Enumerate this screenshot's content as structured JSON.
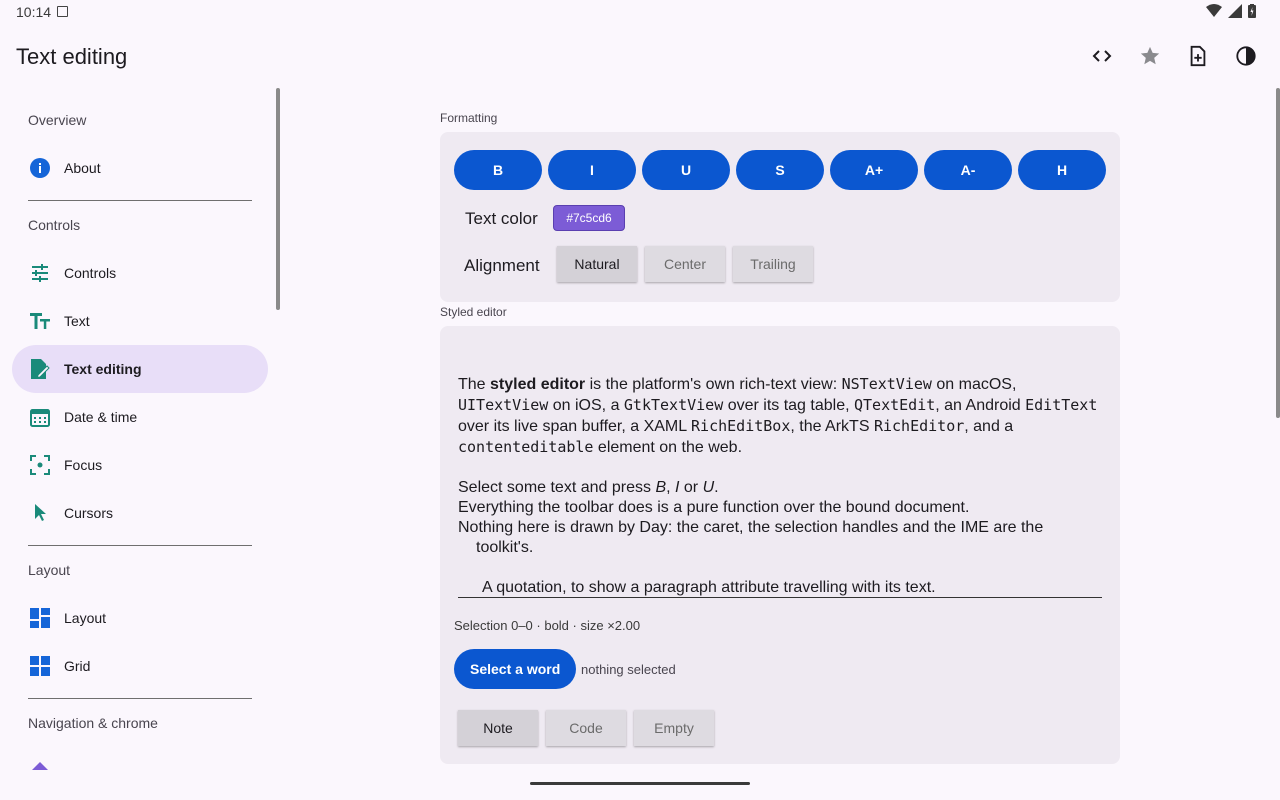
{
  "status": {
    "time": "10:14"
  },
  "appbar": {
    "title": "Text editing",
    "actions": [
      "code-icon",
      "star-icon",
      "new-file-icon",
      "contrast-icon"
    ]
  },
  "sidebar": {
    "sections": [
      {
        "title": "Overview",
        "items": [
          {
            "label": "About",
            "icon": "info-icon"
          }
        ]
      },
      {
        "title": "Controls",
        "items": [
          {
            "label": "Controls",
            "icon": "tune-icon"
          },
          {
            "label": "Text",
            "icon": "text-icon"
          },
          {
            "label": "Text editing",
            "icon": "edit-doc-icon",
            "active": true
          },
          {
            "label": "Date & time",
            "icon": "calendar-icon"
          },
          {
            "label": "Focus",
            "icon": "focus-icon"
          },
          {
            "label": "Cursors",
            "icon": "cursor-icon"
          }
        ]
      },
      {
        "title": "Layout",
        "items": [
          {
            "label": "Layout",
            "icon": "layout-icon"
          },
          {
            "label": "Grid",
            "icon": "grid-icon"
          }
        ]
      },
      {
        "title": "Navigation & chrome",
        "items": []
      }
    ]
  },
  "formatting": {
    "label": "Formatting",
    "buttons": [
      "B",
      "I",
      "U",
      "S",
      "A+",
      "A-",
      "H"
    ],
    "text_color_label": "Text color",
    "text_color_value": "#7c5cd6",
    "alignment_label": "Alignment",
    "alignment_options": [
      "Natural",
      "Center",
      "Trailing"
    ],
    "alignment_selected": "Natural"
  },
  "styled_editor": {
    "label": "Styled editor",
    "p1": {
      "t1": "The ",
      "b1": "styled editor",
      "t2": " is the platform's own rich-text view: ",
      "m1": "NSTextView",
      "t3": " on macOS, ",
      "m2": "UITextView",
      "t4": " on iOS, a ",
      "m3": "GtkTextView",
      "t5": " over its tag table, ",
      "m4": "QTextEdit",
      "t6": ", an Android ",
      "m5": "EditText",
      "t7": " over its live span buffer, a XAML ",
      "m6": "RichEditBox",
      "t8": ", the ArkTS ",
      "m7": "RichEditor",
      "t9": ", and a ",
      "m8": "contenteditable",
      "t10": " element on the web."
    },
    "p2": {
      "t1": "Select some text and press ",
      "i1": "B",
      "t2": ", ",
      "i2": "I",
      "t3": " or ",
      "i3": "U",
      "t4": "."
    },
    "p3": "Everything the toolbar does is a pure function over the bound document.",
    "p4": "Nothing here is drawn by Day: the caret, the selection handles and the IME are the toolkit's.",
    "p5": "A quotation, to show a paragraph attribute travelling with its text.",
    "selection_info": "Selection 0–0 · bold · size ×2.00",
    "select_word_label": "Select a word",
    "selection_status": "nothing selected",
    "presets": [
      "Note",
      "Code",
      "Empty"
    ],
    "preset_selected": "Note"
  },
  "colors": {
    "accent": "#0b57d0",
    "nav_active": "#e8def8",
    "card": "#efeaf2",
    "chip": "#7c5cd6",
    "icon_teal": "#1a8a7a",
    "icon_blue": "#1565d8"
  }
}
